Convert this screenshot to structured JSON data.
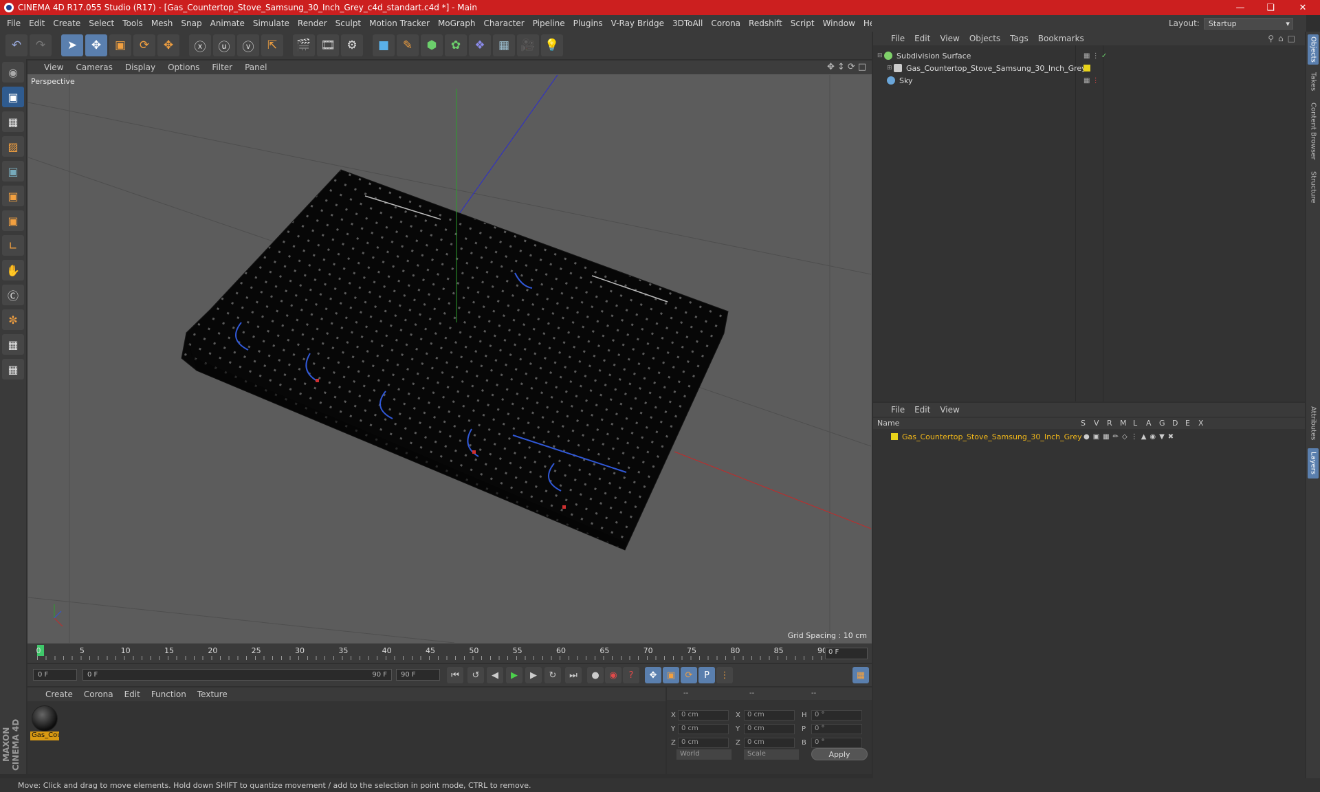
{
  "window": {
    "title": "CINEMA 4D R17.055 Studio (R17) - [Gas_Countertop_Stove_Samsung_30_Inch_Grey_c4d_standart.c4d *] - Main",
    "layout_label": "Layout:",
    "layout_value": "Startup"
  },
  "menu": [
    "File",
    "Edit",
    "Create",
    "Select",
    "Tools",
    "Mesh",
    "Snap",
    "Animate",
    "Simulate",
    "Render",
    "Sculpt",
    "Motion Tracker",
    "MoGraph",
    "Character",
    "Pipeline",
    "Plugins",
    "V-Ray Bridge",
    "3DToAll",
    "Corona",
    "Redshift",
    "Script",
    "Window",
    "Help"
  ],
  "toolbar_icons": [
    "undo-icon",
    "redo-icon",
    "live-select-icon",
    "move-icon",
    "scale-icon",
    "rotate-icon",
    "recent-tool-icon",
    "x-axis-icon",
    "y-axis-icon",
    "z-axis-icon",
    "coordinate-system-icon",
    "render-view-icon",
    "render-picture-viewer-icon",
    "edit-render-settings-icon",
    "cube-primitive-icon",
    "pen-spline-icon",
    "subdivision-icon",
    "cloner-icon",
    "deformer-icon",
    "floor-icon",
    "camera-icon",
    "light-icon"
  ],
  "viewport": {
    "menu": [
      "View",
      "Cameras",
      "Display",
      "Options",
      "Filter",
      "Panel"
    ],
    "label": "Perspective",
    "grid_spacing": "Grid Spacing : 10 cm"
  },
  "timeline": {
    "ticks": [
      "0",
      "5",
      "10",
      "15",
      "20",
      "25",
      "30",
      "35",
      "40",
      "45",
      "50",
      "55",
      "60",
      "65",
      "70",
      "75",
      "80",
      "85",
      "90"
    ],
    "current_frame": "0 F",
    "start_field": "0 F",
    "range_start": "0 F",
    "range_end": "90 F",
    "end_field": "90 F"
  },
  "material_panel": {
    "menu": [
      "Create",
      "Corona",
      "Edit",
      "Function",
      "Texture"
    ],
    "material_name": "Gas_Cou"
  },
  "coords": {
    "headers": [
      "--",
      "--",
      "--"
    ],
    "rows": [
      {
        "l1": "X",
        "v1": "0 cm",
        "l2": "X",
        "v2": "0 cm",
        "l3": "H",
        "v3": "0 °"
      },
      {
        "l1": "Y",
        "v1": "0 cm",
        "l2": "Y",
        "v2": "0 cm",
        "l3": "P",
        "v3": "0 °"
      },
      {
        "l1": "Z",
        "v1": "0 cm",
        "l2": "Z",
        "v2": "0 cm",
        "l3": "B",
        "v3": "0 °"
      }
    ],
    "world": "World",
    "scale": "Scale",
    "apply": "Apply"
  },
  "objects": {
    "menu": [
      "File",
      "Edit",
      "View",
      "Objects",
      "Tags",
      "Bookmarks"
    ],
    "items": [
      {
        "name": "Subdivision Surface",
        "color": "#7fd16a"
      },
      {
        "name": "Gas_Countertop_Stove_Samsung_30_Inch_Grey",
        "color": "#cccccc"
      },
      {
        "name": "Sky",
        "color": "#6aa6d9"
      }
    ]
  },
  "layers": {
    "menu": [
      "File",
      "Edit",
      "View"
    ],
    "header_name": "Name",
    "columns": [
      "S",
      "V",
      "R",
      "M",
      "L",
      "A",
      "G",
      "D",
      "E",
      "X"
    ],
    "items": [
      {
        "name": "Gas_Countertop_Stove_Samsung_30_Inch_Grey",
        "color": "#e8d31a"
      }
    ]
  },
  "right_tabs": [
    "Objects",
    "Takes",
    "Content Browser",
    "Structure",
    "Attributes",
    "Layers"
  ],
  "status": "Move: Click and drag to move elements. Hold down SHIFT to quantize movement / add to the selection in point mode, CTRL to remove.",
  "brand": "MAXON CINEMA 4D"
}
